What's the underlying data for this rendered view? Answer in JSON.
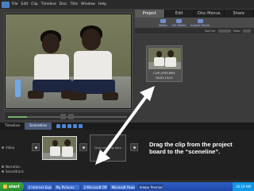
{
  "menubar": {
    "items": [
      "File",
      "Edit",
      "Clip",
      "Timeline",
      "Disc",
      "Title",
      "Window",
      "Help"
    ],
    "save": "Save",
    "undo": "Undo",
    "redo": "Redo",
    "organizer": "Organizer",
    "fullscreen": "Full Screen"
  },
  "tabs": [
    "Project",
    "Edit",
    "Disc Menus",
    "Share"
  ],
  "project_tools": [
    "Media",
    "Get Media",
    "Instant Movie"
  ],
  "filter": {
    "sort_label": "Sort by:",
    "view_label": "View:"
  },
  "clip": {
    "name": "CLIP_0793.MOV",
    "duration": "00;01;13;21"
  },
  "timeline_tabs": [
    "Timeline",
    "Sceneline"
  ],
  "tracks": {
    "video": "Video",
    "narration": "Narration",
    "soundtrack": "Soundtrack"
  },
  "sceneline": {
    "drop_text": "Drag next clip here"
  },
  "instruction": "Drag the clip from the project board to the “sceneline”.",
  "taskbar": {
    "start": "start",
    "items": [
      "2 Internet Explorer",
      "My Pictures",
      "2 Microsoft Office ...",
      "Microsoft PowerPoi...",
      "Adobe Premiere Ele..."
    ],
    "clock": "10:19 AM"
  },
  "colors": {
    "accent": "#4a5c7a",
    "selected_tab": "#5a5a5a",
    "taskbar": "#2e5ec4",
    "start": "#3aa83a"
  }
}
